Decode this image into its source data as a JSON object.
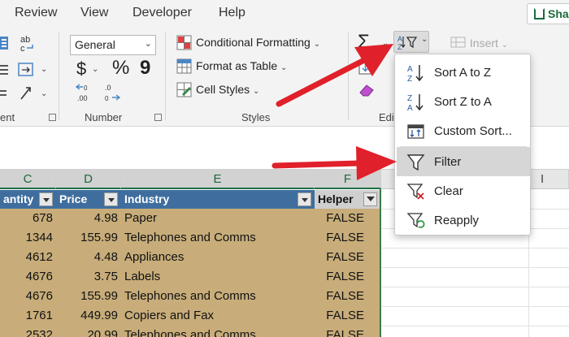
{
  "ribbon_tabs": [
    "Review",
    "View",
    "Developer",
    "Help"
  ],
  "share_label": "Sha",
  "number_group": {
    "format_value": "General",
    "currency_symbol": "$",
    "percent_symbol": "%",
    "comma_symbol": "9",
    "increase_decimal": ".00",
    "decrease_decimal": ".0",
    "label": "Number"
  },
  "styles_group": {
    "conditional_formatting": "Conditional Formatting",
    "format_as_table": "Format as Table",
    "cell_styles": "Cell Styles",
    "label": "Styles"
  },
  "alignment_label_partial": "ent",
  "editing_label_partial": "Edit",
  "cells_group": {
    "insert": "Insert"
  },
  "sort_filter_menu": {
    "items": [
      "Sort A to Z",
      "Sort Z to A",
      "Custom Sort...",
      "Filter",
      "Clear",
      "Reapply"
    ],
    "highlighted": "Filter"
  },
  "columns": [
    "C",
    "D",
    "E",
    "F",
    "I"
  ],
  "table": {
    "headers": [
      "antity",
      "Price",
      "Industry",
      "Helper"
    ],
    "rows": [
      [
        "678",
        "4.98",
        "Paper",
        "FALSE"
      ],
      [
        "1344",
        "155.99",
        "Telephones and Comms",
        "FALSE"
      ],
      [
        "4612",
        "4.48",
        "Appliances",
        "FALSE"
      ],
      [
        "4676",
        "3.75",
        "Labels",
        "FALSE"
      ],
      [
        "4676",
        "155.99",
        "Telephones and Comms",
        "FALSE"
      ],
      [
        "1761",
        "449.99",
        "Copiers and Fax",
        "FALSE"
      ],
      [
        "2532",
        "20.99",
        "Telephones and Comms",
        "FALSE"
      ]
    ]
  },
  "colors": {
    "table_header": "#3f6e9e",
    "table_body": "#c8ad7a",
    "arrow": "#e0202a",
    "menu_highlight": "#d6d6d6"
  }
}
